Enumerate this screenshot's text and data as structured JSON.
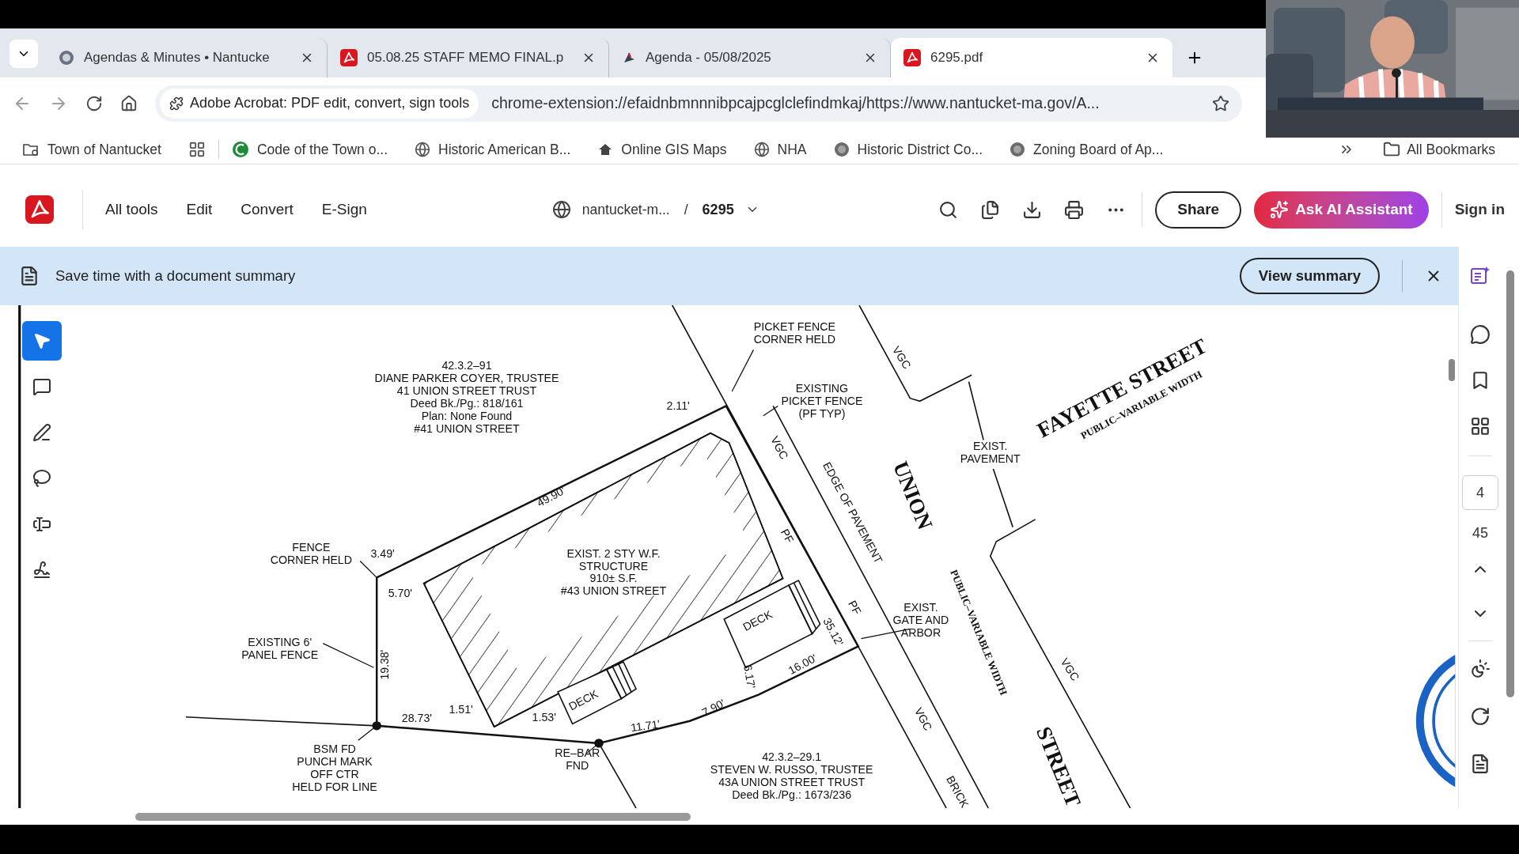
{
  "browser": {
    "tabs": [
      {
        "title": "Agendas & Minutes • Nantucke",
        "selected": false
      },
      {
        "title": "05.08.25 STAFF MEMO FINAL.p",
        "selected": false
      },
      {
        "title": "Agenda - 05/08/2025",
        "selected": false
      },
      {
        "title": "6295.pdf",
        "selected": true
      }
    ],
    "address_bar": {
      "site_chip": "Adobe Acrobat: PDF edit, convert, sign tools",
      "url": "chrome-extension://efaidnbmnnnibpcajpcglclefindmkaj/https://www.nantucket-ma.gov/A..."
    },
    "bookmarks": [
      {
        "label": "Town of Nantucket"
      },
      {
        "label": "Code of the Town o..."
      },
      {
        "label": "Historic American B..."
      },
      {
        "label": "Online GIS Maps"
      },
      {
        "label": "NHA"
      },
      {
        "label": "Historic District Co..."
      },
      {
        "label": "Zoning Board of Ap..."
      }
    ],
    "all_bookmarks": "All Bookmarks"
  },
  "acrobat": {
    "menu": [
      "All tools",
      "Edit",
      "Convert",
      "E-Sign"
    ],
    "breadcrumb": {
      "site": "nantucket-m...",
      "separator": "/",
      "file": "6295"
    },
    "share": "Share",
    "ask_ai": "Ask AI Assistant",
    "sign_in": "Sign in"
  },
  "banner": {
    "text": "Save time with a document summary",
    "button": "View summary"
  },
  "tools": [
    {
      "kind": "select",
      "selected": true
    },
    {
      "kind": "comment",
      "selected": false
    },
    {
      "kind": "pen",
      "selected": false
    },
    {
      "kind": "lasso",
      "selected": false
    },
    {
      "kind": "text",
      "selected": false
    },
    {
      "kind": "sign",
      "selected": false
    }
  ],
  "page_nav": {
    "current": "4",
    "total": "45"
  },
  "drawing": {
    "labels": [
      {
        "kind": "note",
        "lines": [
          "PICKET FENCE",
          "CORNER HELD"
        ]
      },
      {
        "kind": "note",
        "lines": [
          "42.3.2–91",
          "DIANE PARKER COYER, TRUSTEE",
          "41 UNION STREET TRUST",
          "Deed Bk./Pg.: 818/161",
          "Plan: None Found",
          "#41 UNION STREET"
        ]
      },
      {
        "kind": "dimension",
        "lines": [
          "2.11'"
        ]
      },
      {
        "kind": "note",
        "lines": [
          "EXISTING",
          "PICKET FENCE",
          "(PF TYP)"
        ]
      },
      {
        "kind": "note",
        "lines": [
          "VGC"
        ]
      },
      {
        "kind": "street",
        "lines": [
          "FAYETTE STREET"
        ]
      },
      {
        "kind": "street_sub",
        "lines": [
          "PUBLIC–VARIABLE WIDTH"
        ]
      },
      {
        "kind": "note",
        "lines": [
          "EXIST.",
          "PAVEMENT"
        ]
      },
      {
        "kind": "note",
        "lines": [
          "VGC"
        ]
      },
      {
        "kind": "note",
        "lines": [
          "EDGE OF PAVEMENT"
        ]
      },
      {
        "kind": "street",
        "lines": [
          "UNION"
        ]
      },
      {
        "kind": "dimension",
        "lines": [
          "49.90'"
        ]
      },
      {
        "kind": "note",
        "lines": [
          "EXIST. 2 STY W.F.",
          "STRUCTURE",
          "910± S.F.",
          "#43 UNION STREET"
        ]
      },
      {
        "kind": "note",
        "lines": [
          "PF"
        ]
      },
      {
        "kind": "note",
        "lines": [
          "FENCE",
          "CORNER HELD"
        ]
      },
      {
        "kind": "dimension",
        "lines": [
          "3.49'"
        ]
      },
      {
        "kind": "dimension",
        "lines": [
          "5.70'"
        ]
      },
      {
        "kind": "street_sub",
        "lines": [
          "PUBLIC–VARIABLE WIDTH"
        ]
      },
      {
        "kind": "note",
        "lines": [
          "EXIST.",
          "GATE AND",
          "ARBOR"
        ]
      },
      {
        "kind": "note",
        "lines": [
          "DECK"
        ]
      },
      {
        "kind": "note",
        "lines": [
          "PF"
        ]
      },
      {
        "kind": "dimension",
        "lines": [
          "35.12'"
        ]
      },
      {
        "kind": "note",
        "lines": [
          "EXISTING 6'",
          "PANEL FENCE"
        ]
      },
      {
        "kind": "dimension",
        "lines": [
          "19.38'"
        ]
      },
      {
        "kind": "dimension",
        "lines": [
          "16.00'"
        ]
      },
      {
        "kind": "dimension",
        "lines": [
          "6.17'"
        ]
      },
      {
        "kind": "note",
        "lines": [
          "VGC"
        ]
      },
      {
        "kind": "dimension",
        "lines": [
          "7.90'"
        ]
      },
      {
        "kind": "note",
        "lines": [
          "DECK"
        ]
      },
      {
        "kind": "dimension",
        "lines": [
          "1.51'"
        ]
      },
      {
        "kind": "dimension",
        "lines": [
          "28.73'"
        ]
      },
      {
        "kind": "dimension",
        "lines": [
          "1.53'"
        ]
      },
      {
        "kind": "dimension",
        "lines": [
          "11.71'"
        ]
      },
      {
        "kind": "note",
        "lines": [
          "VGC"
        ]
      },
      {
        "kind": "note",
        "lines": [
          "BSM FD",
          "PUNCH MARK",
          "OFF CTR",
          "HELD FOR LINE"
        ]
      },
      {
        "kind": "note",
        "lines": [
          "RE–BAR",
          "FND"
        ]
      },
      {
        "kind": "note",
        "lines": [
          "42.3.2–29.1",
          "STEVEN W. RUSSO, TRUSTEE",
          "43A UNION STREET TRUST",
          "Deed Bk./Pg.: 1673/236"
        ]
      },
      {
        "kind": "street",
        "lines": [
          "STREET"
        ]
      },
      {
        "kind": "note",
        "lines": [
          "BRICK"
        ]
      }
    ]
  }
}
